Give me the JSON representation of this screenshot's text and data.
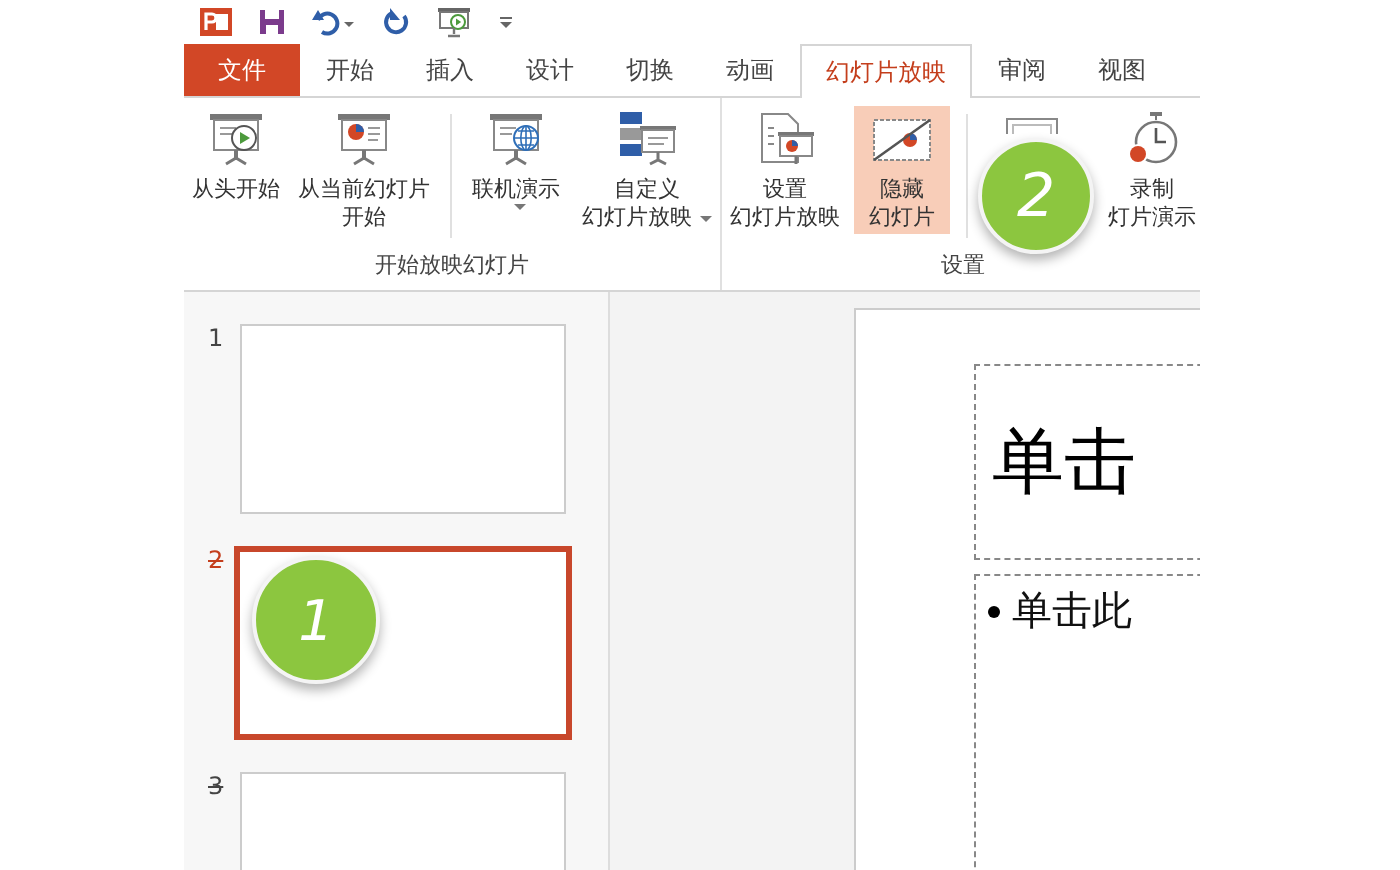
{
  "quick_access": [
    {
      "kind": "app"
    },
    {
      "kind": "save"
    },
    {
      "kind": "undo"
    },
    {
      "kind": "redo"
    },
    {
      "kind": "present"
    },
    {
      "kind": "customize"
    }
  ],
  "tabs": [
    {
      "label": "文件",
      "kind": "file",
      "selected": false
    },
    {
      "label": "开始",
      "kind": "tab",
      "selected": false
    },
    {
      "label": "插入",
      "kind": "tab",
      "selected": false
    },
    {
      "label": "设计",
      "kind": "tab",
      "selected": false
    },
    {
      "label": "切换",
      "kind": "tab",
      "selected": false
    },
    {
      "label": "动画",
      "kind": "tab",
      "selected": false
    },
    {
      "label": "幻灯片放映",
      "kind": "tab",
      "selected": true
    },
    {
      "label": "审阅",
      "kind": "tab",
      "selected": false
    },
    {
      "label": "视图",
      "kind": "tab",
      "selected": false
    }
  ],
  "ribbon": {
    "groups": [
      {
        "label": "开始放映幻灯片",
        "buttons": [
          {
            "kind": "play",
            "lines": [
              "从头开始"
            ],
            "dropdown": false,
            "highlighted": false
          },
          {
            "kind": "current",
            "lines": [
              "从当前幻灯片",
              "开始"
            ],
            "dropdown": false,
            "highlighted": false
          },
          {
            "kind": "online",
            "lines": [
              "联机演示"
            ],
            "dropdown": true,
            "highlighted": false
          },
          {
            "kind": "custom",
            "lines": [
              "自定义",
              "幻灯片放映"
            ],
            "dropdown": true,
            "highlighted": false
          }
        ]
      },
      {
        "label": "设置",
        "buttons": [
          {
            "kind": "setup",
            "lines": [
              "设置",
              "幻灯片放映"
            ],
            "dropdown": false,
            "highlighted": false
          },
          {
            "kind": "hide",
            "lines": [
              "隐藏",
              "幻灯片"
            ],
            "dropdown": false,
            "highlighted": true
          },
          {
            "kind": "monitor",
            "callout": "2"
          },
          {
            "kind": "record",
            "lines": [
              "录制",
              "灯片演示"
            ],
            "dropdown": false,
            "highlighted": false
          }
        ]
      }
    ]
  },
  "slides": [
    {
      "number": "1",
      "hidden": false,
      "selected": false
    },
    {
      "number": "2",
      "hidden": true,
      "selected": true,
      "callout": "1"
    },
    {
      "number": "3",
      "hidden": true,
      "selected": false
    }
  ],
  "editor": {
    "title": "单击",
    "body": "单击此"
  }
}
